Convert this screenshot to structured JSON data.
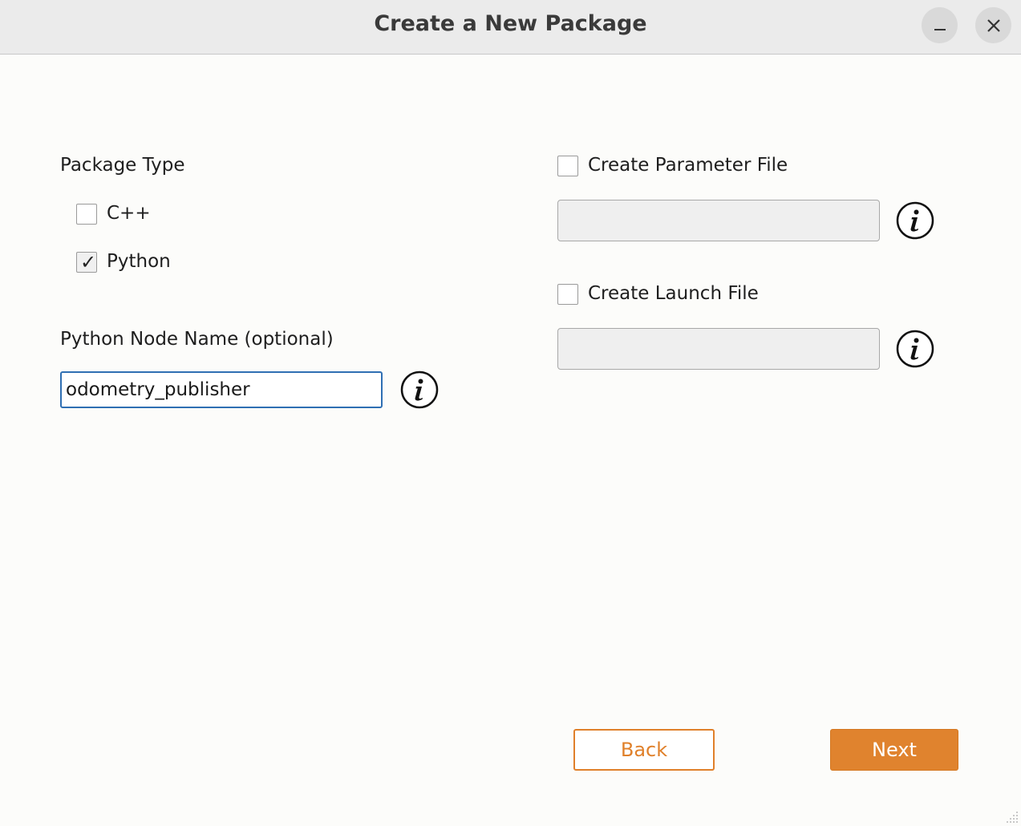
{
  "window": {
    "title": "Create a New Package",
    "minimize_icon": "minimize-icon",
    "close_icon": "close-icon"
  },
  "package_type": {
    "heading": "Package Type",
    "options": [
      {
        "label": "C++",
        "checked": false
      },
      {
        "label": "Python",
        "checked": true
      }
    ]
  },
  "node_name": {
    "label": "Python Node Name (optional)",
    "value": "odometry_publisher",
    "info_icon": "info-icon"
  },
  "parameter_file": {
    "label": "Create Parameter File",
    "checked": false,
    "value": "",
    "info_icon": "info-icon"
  },
  "launch_file": {
    "label": "Create Launch File",
    "checked": false,
    "value": "",
    "info_icon": "info-icon"
  },
  "footer": {
    "back_label": "Back",
    "next_label": "Next"
  },
  "colors": {
    "accent": "#e0832e",
    "focus": "#2f6fb3",
    "background": "#fcfcfa",
    "titlebar": "#ebebeb"
  }
}
